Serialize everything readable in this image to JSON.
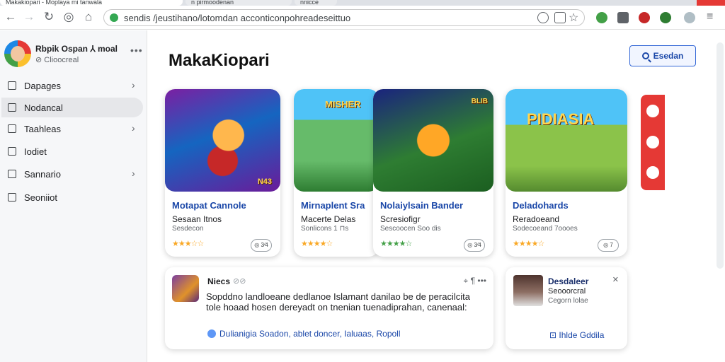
{
  "browser": {
    "tabs": [
      "Makakiopari - Moplaya mi tanwala",
      "n pirmoodenan",
      "nnicce"
    ],
    "url": "sendis /jeustihano/lotomdan acconticonpohreadeseittuo"
  },
  "sidebar": {
    "user_name": "Rbpik Ospan ⅄ moal",
    "user_sub": "⊘ Clioocreal",
    "items": [
      {
        "label": "Dapages",
        "chevron": "›"
      },
      {
        "label": "Nodancal",
        "chevron": ""
      },
      {
        "label": "Taahleas",
        "chevron": "›"
      },
      {
        "label": "Iodiet",
        "chevron": ""
      },
      {
        "label": "Sannario",
        "chevron": "›"
      },
      {
        "label": "Seoniiot",
        "chevron": ""
      }
    ]
  },
  "main": {
    "title": "MakaKiopari",
    "search_label": "Esedan",
    "cards": [
      {
        "title": "Motapat Cannole",
        "sub": "Sesaan Itnos",
        "meta": "Sesdecon",
        "stars": "★★★☆☆",
        "pill": "◎ 3⁄4",
        "art_text": "N43"
      },
      {
        "title": "Mirnaplent Sra",
        "sub": "Macerte Delas",
        "meta": "Sonlicons 1 ⊓s",
        "stars": "★★★★☆",
        "pill": "",
        "art_text": "MISHER"
      },
      {
        "title": "Nolaiylsain Bander",
        "sub": "Scresiofigr",
        "meta": "Sescoocen Soo dis",
        "stars": "★★★★☆",
        "pill": "◎ 3⁄4",
        "art_text": "BLIB"
      },
      {
        "title": "Deladohards",
        "sub": "Reradoeand",
        "meta": "Sodecoeand 7oooes",
        "stars": "★★★★☆",
        "pill": "◎ 7",
        "art_text": "PIDIASIA"
      }
    ],
    "post": {
      "author": "Niecs",
      "badge": "⊘⊘",
      "actions": "⌖ ¶  •••",
      "body": "Sopddno landloeane dedlanoe Islamant danilao be de peracilcita tole hoaad hosen dereyadt on tnenian tuenadiprahan, canenaal:",
      "links": "Dulianigia  Soadon,  ablet  doncer,  Ialuaas,  Ropoll"
    },
    "promo": {
      "title": "Desdaleer",
      "sub": "Seooorcral",
      "meta": "Cegorn lolae",
      "close": "✕",
      "links": "⊡  Ihlde   Gddila"
    }
  }
}
